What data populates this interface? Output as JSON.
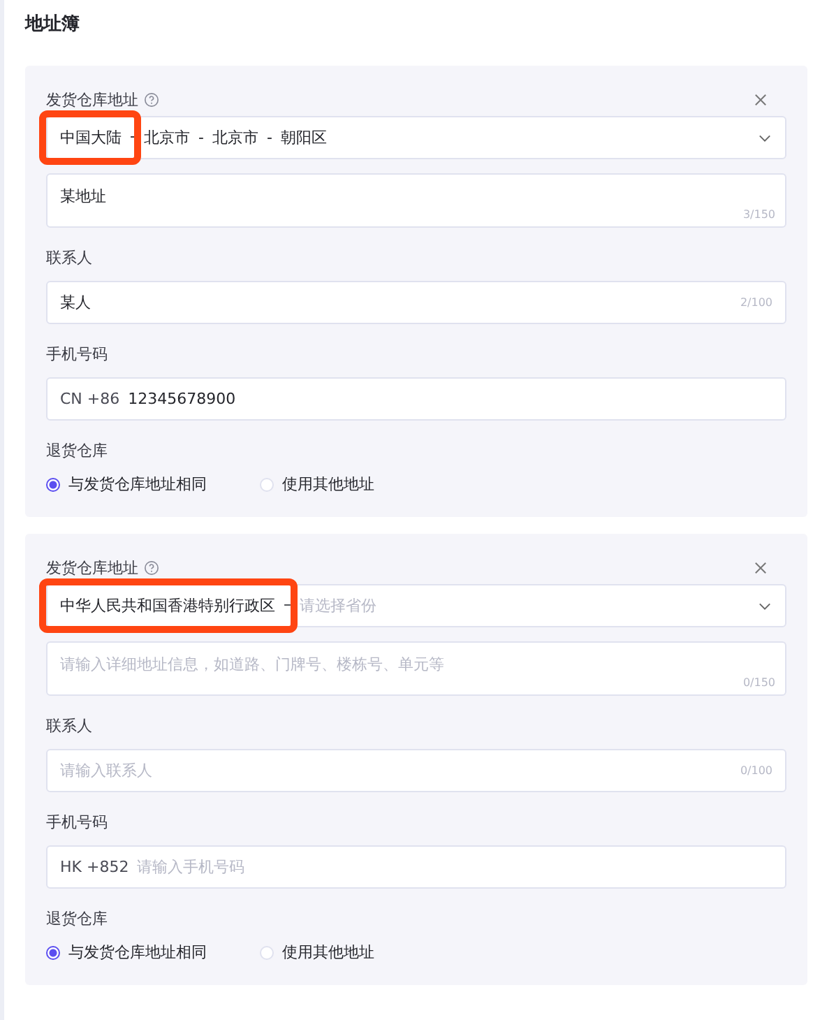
{
  "title": "地址簿",
  "cards": [
    {
      "address_label": "发货仓库地址",
      "region": {
        "segments": [
          "中国大陆",
          "-",
          "北京市",
          "-",
          "北京市",
          "-",
          "朝阳区"
        ],
        "highlighted": true
      },
      "detail": {
        "value": "某地址",
        "counter": "3/150"
      },
      "contact_label": "联系人",
      "contact": {
        "value": "某人",
        "counter": "2/100"
      },
      "phone_label": "手机号码",
      "phone": {
        "prefix": "CN +86",
        "value": "12345678900"
      },
      "return_label": "退货仓库",
      "return_options": [
        {
          "label": "与发货仓库地址相同",
          "selected": true
        },
        {
          "label": "使用其他地址",
          "selected": false
        }
      ]
    },
    {
      "address_label": "发货仓库地址",
      "region": {
        "segments": [
          "中华人民共和国香港特别行政区",
          "–"
        ],
        "placeholder": "请选择省份",
        "highlighted": true
      },
      "detail": {
        "placeholder": "请输入详细地址信息，如道路、门牌号、楼栋号、单元等",
        "counter": "0/150"
      },
      "contact_label": "联系人",
      "contact": {
        "placeholder": "请输入联系人",
        "counter": "0/100"
      },
      "phone_label": "手机号码",
      "phone": {
        "prefix": "HK +852",
        "placeholder": "请输入手机号码"
      },
      "return_label": "退货仓库",
      "return_options": [
        {
          "label": "与发货仓库地址相同",
          "selected": true
        },
        {
          "label": "使用其他地址",
          "selected": false
        }
      ]
    }
  ]
}
